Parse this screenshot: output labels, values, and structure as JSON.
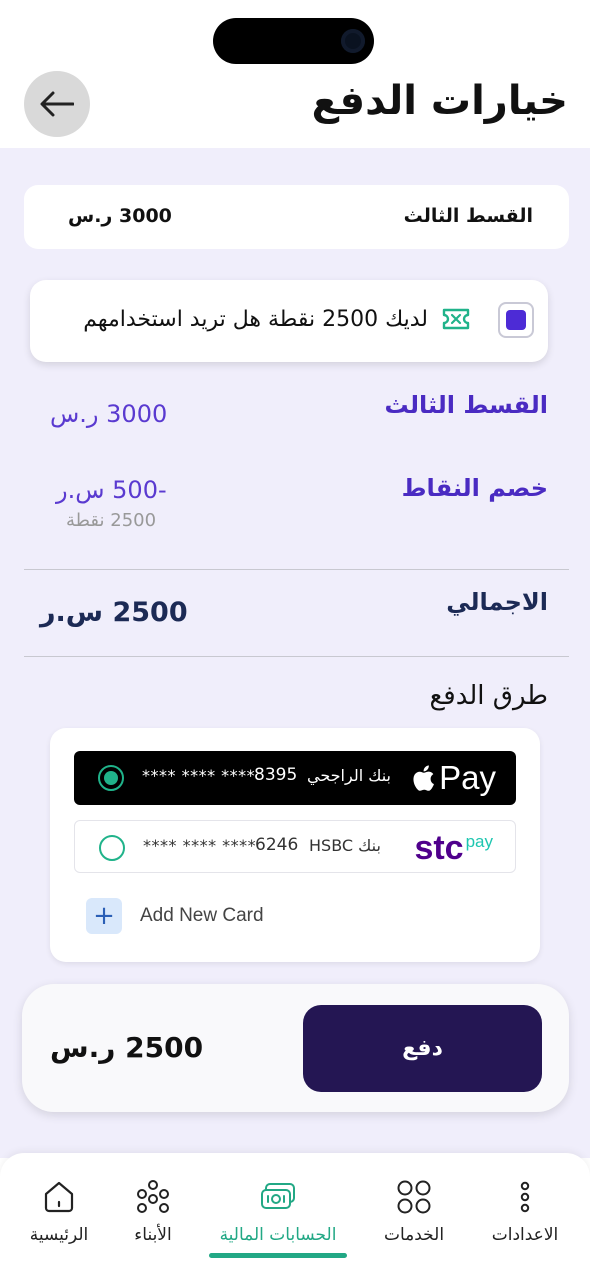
{
  "header": {
    "title": "خيارات الدفع",
    "back_icon": "arrow-left-icon"
  },
  "installment_card": {
    "label": "القسط الثالث",
    "amount": "3000 ر.س"
  },
  "points_prompt": {
    "text": "لديك 2500 نقطة هل تريد استخدامهم",
    "checked": true,
    "checkbox_color": "#4d2bd6",
    "icon": "ticket-icon"
  },
  "summary": {
    "installment_label": "القسط الثالث",
    "installment_value": "3000 ر.س",
    "discount_label": "خصم النقاط",
    "discount_value": "-500 س.ر",
    "discount_points": "2500 نقطة",
    "total_label": "الاجمالي",
    "total_value": "2500 س.ر"
  },
  "payment_methods": {
    "title": "طرق الدفع",
    "methods": [
      {
        "brand": "Pay",
        "bank": "بنك الراجحي",
        "last4": "8395",
        "mask": "**** **** ****",
        "selected": true
      },
      {
        "brand_main": "stc",
        "brand_sub": "pay",
        "bank": "بنك HSBC",
        "last4": "6246",
        "mask": "**** **** ****",
        "selected": false
      }
    ],
    "add_card_label": "Add New Card"
  },
  "pay_bar": {
    "amount": "2500 ر.س",
    "button_label": "دفع",
    "button_color": "#241653"
  },
  "tabbar": {
    "accent": "#22a885",
    "tabs": [
      {
        "label": "الاعدادات",
        "icon": "more-vertical-icon"
      },
      {
        "label": "الخدمات",
        "icon": "grid-icon"
      },
      {
        "label": "الحسابات المالية",
        "icon": "money-icon",
        "active": true
      },
      {
        "label": "الأبناء",
        "icon": "family-icon"
      },
      {
        "label": "الرئيسية",
        "icon": "home-icon"
      }
    ]
  }
}
